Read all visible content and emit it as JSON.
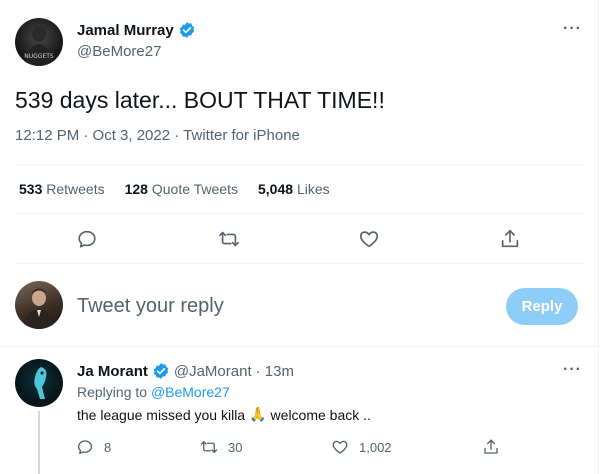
{
  "tweet": {
    "author_name": "Jamal Murray",
    "author_handle": "@BeMore27",
    "text": "539 days later... BOUT THAT TIME!!",
    "time": "12:12 PM · Oct 3, 2022",
    "separator": " · ",
    "source": "Twitter for iPhone",
    "stats": {
      "retweets_count": "533",
      "retweets_label": "Retweets",
      "quotes_count": "128",
      "quotes_label": "Quote Tweets",
      "likes_count": "5,048",
      "likes_label": "Likes"
    }
  },
  "composer": {
    "placeholder": "Tweet your reply",
    "reply_button": "Reply"
  },
  "reply": {
    "author_name": "Ja Morant",
    "author_handle": "@JaMorant",
    "time": "· 13m",
    "replying_to_prefix": "Replying to",
    "replying_to_handle": "@BeMore27",
    "text_before": "the league missed you killa",
    "emoji": "🙏",
    "text_after": "welcome back ..",
    "replies_count": "8",
    "retweets_count": "30",
    "likes_count": "1,002"
  },
  "icons": {
    "verified": "verified-badge-icon",
    "more": "more-options-icon",
    "reply": "reply-icon",
    "retweet": "retweet-icon",
    "like": "heart-icon",
    "share": "share-icon"
  },
  "colors": {
    "accent": "#1d9bf0",
    "reply_button_disabled": "#8ecdf8",
    "secondary_text": "#536471",
    "divider": "#eff3f4"
  }
}
